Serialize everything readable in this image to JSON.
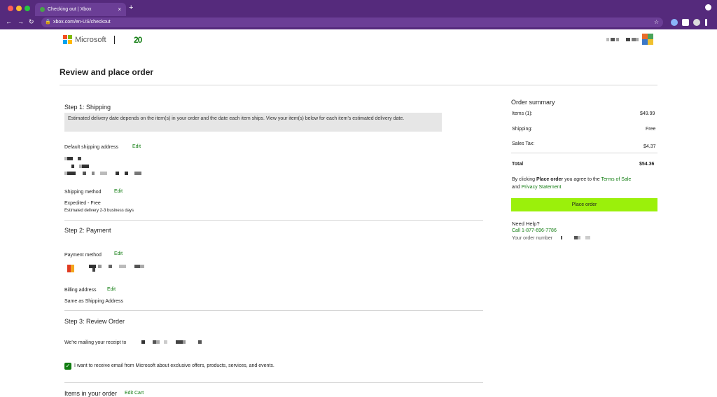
{
  "browser": {
    "tab_title": "Checking out | Xbox",
    "url": "xbox.com/en-US/checkout",
    "new_tab_label": "+",
    "tab_close": "×",
    "back": "←",
    "forward": "→",
    "reload": "↻",
    "bookmark": "☆"
  },
  "header": {
    "brand": "Microsoft",
    "xbox_anniversary": "20"
  },
  "page": {
    "title": "Review and place order"
  },
  "shipping": {
    "heading": "Step 1: Shipping",
    "info": "Estimated delivery date depends on the item(s) in your order and the date each item ships. View your item(s) below for each item's estimated delivery date.",
    "address_label": "Default shipping address",
    "edit": "Edit",
    "method_label": "Shipping method",
    "method_value": "Expedited - Free",
    "method_note": "Estimated delivery 2-3 business days"
  },
  "payment": {
    "heading": "Step 2: Payment",
    "method_label": "Payment method",
    "edit": "Edit",
    "billing_label": "Billing address",
    "billing_value": "Same as Shipping Address"
  },
  "review": {
    "heading": "Step 3: Review Order",
    "receipt_text": "We're mailing your receipt to",
    "email_optin": "I want to receive email from Microsoft about exclusive offers, products, services, and events.",
    "items_heading": "Items in your order",
    "edit_cart": "Edit Cart"
  },
  "summary": {
    "heading": "Order summary",
    "items_label": "Items (1):",
    "items_value": "$49.99",
    "shipping_label": "Shipping:",
    "shipping_value": "Free",
    "tax_label": "Sales Tax:",
    "tax_value": "$4.37",
    "total_label": "Total",
    "total_value": "$54.36",
    "agree_pre": "By clicking ",
    "agree_bold": "Place order",
    "agree_mid": " you agree to the ",
    "terms_link": "Terms of Sale",
    "agree_and": "and ",
    "privacy_link": "Privacy Statement",
    "place_order": "Place order",
    "help_heading": "Need Help?",
    "call_label": "Call ",
    "phone": "1-877-696-7786",
    "order_number_label": "Your order number"
  },
  "colors": {
    "browser_purple": "#552a7c",
    "xbox_green": "#107c10",
    "place_order_bg": "#9bf00b"
  }
}
